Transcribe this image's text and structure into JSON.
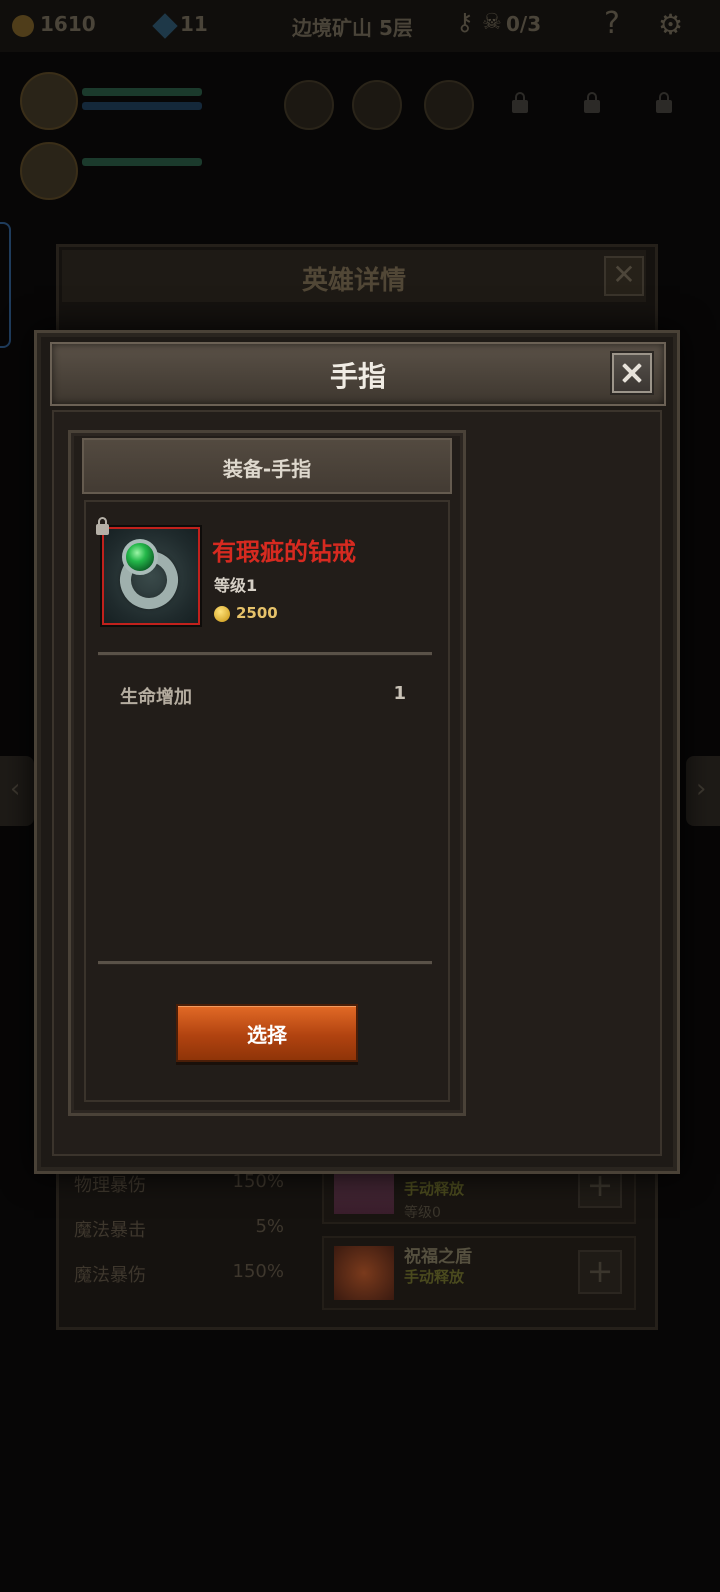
{
  "topbar": {
    "gold": "1610",
    "gems": "11",
    "location": "边境矿山 5层",
    "kills": "0/3",
    "help": "?"
  },
  "hero_details": {
    "title": "英雄详情",
    "stats": [
      {
        "name": "物理暴伤",
        "value": "150%"
      },
      {
        "name": "魔法暴击",
        "value": "5%"
      },
      {
        "name": "魔法暴伤",
        "value": "150%"
      }
    ],
    "skills": [
      {
        "name": "",
        "type": "手动释放",
        "level": "等级0"
      },
      {
        "name": "祝福之盾",
        "type": "手动释放",
        "level": ""
      }
    ]
  },
  "modal": {
    "title": "手指",
    "equip_panel_title": "装备-手指",
    "item": {
      "name": "有瑕疵的钻戒",
      "level": "等级1",
      "price": "2500",
      "icon": "diamond-ring-icon"
    },
    "attributes": [
      {
        "name": "生命增加",
        "value": "1"
      }
    ],
    "select_label": "选择"
  },
  "colors": {
    "item_name": "#d72a20",
    "price": "#e6c26a",
    "button": "#c2501a"
  }
}
